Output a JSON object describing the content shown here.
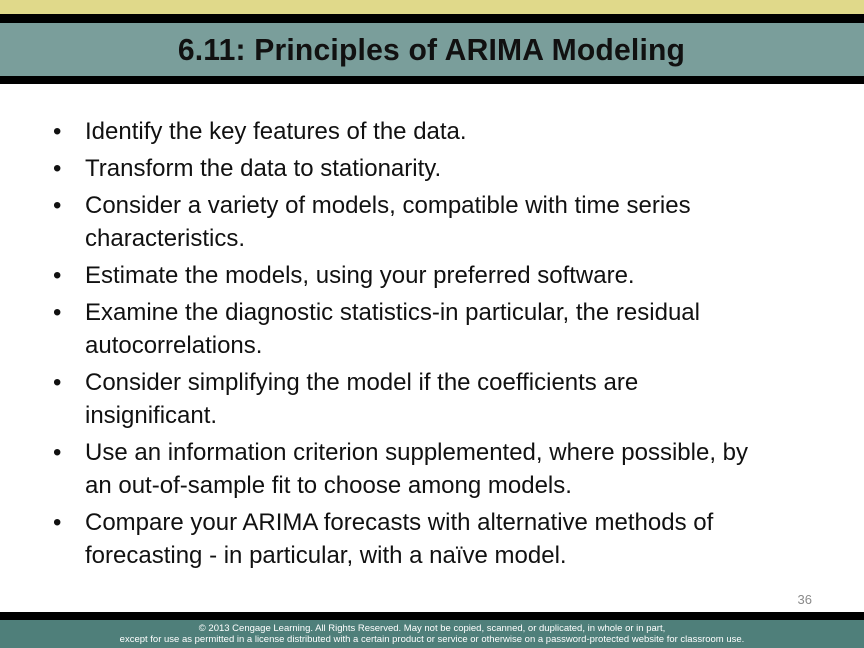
{
  "slide": {
    "title": "6.11: Principles of ARIMA Modeling",
    "bullet_glyph": "•",
    "bullets": [
      {
        "lines": [
          "Identify the key features of the data."
        ]
      },
      {
        "lines": [
          "Transform the data to stationarity."
        ]
      },
      {
        "lines": [
          "Consider a variety of models, compatible with time series",
          "characteristics."
        ]
      },
      {
        "lines": [
          "Estimate the models, using your preferred software."
        ]
      },
      {
        "lines": [
          "Examine the diagnostic statistics-in particular, the residual",
          "autocorrelations."
        ]
      },
      {
        "lines": [
          "Consider simplifying the model if the coefficients are",
          "insignificant."
        ]
      },
      {
        "lines": [
          "Use an information criterion supplemented, where possible, by",
          "an out-of-sample fit to choose among models."
        ]
      },
      {
        "lines": [
          "Compare your ARIMA forecasts with alternative methods of",
          "forecasting - in particular, with a naïve model."
        ]
      }
    ],
    "page_number": "36",
    "footer": {
      "line1": "© 2013 Cengage Learning. All Rights Reserved. May not be copied, scanned, or duplicated, in whole or in part,",
      "line2": "except for use as permitted in a license distributed with a certain product or service or otherwise on a password-protected website for classroom use."
    }
  },
  "colors": {
    "top_band": "#e0d98a",
    "title_band": "#7a9e9b",
    "footer_band": "#4f7f7a",
    "divider": "#000000",
    "text": "#111111",
    "page_number": "#8a8a8a"
  }
}
